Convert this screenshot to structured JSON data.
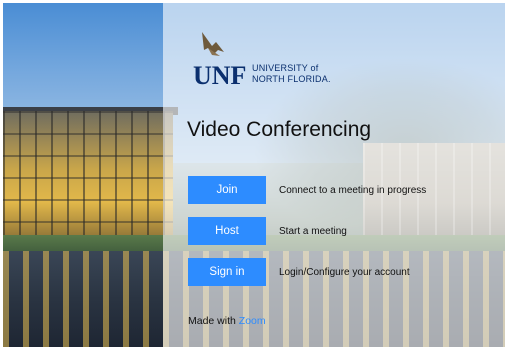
{
  "logo": {
    "mark": "UNF",
    "line1": "UNIVERSITY of",
    "line2": "NORTH FLORIDA."
  },
  "title": "Video Conferencing",
  "actions": [
    {
      "label": "Join",
      "description": "Connect to a meeting in progress"
    },
    {
      "label": "Host",
      "description": "Start a meeting"
    },
    {
      "label": "Sign in",
      "description": "Login/Configure your account"
    }
  ],
  "footer": {
    "prefix": "Made with",
    "link": "Zoom"
  },
  "colors": {
    "button": "#2d8cff",
    "brand": "#0a2f6e"
  }
}
